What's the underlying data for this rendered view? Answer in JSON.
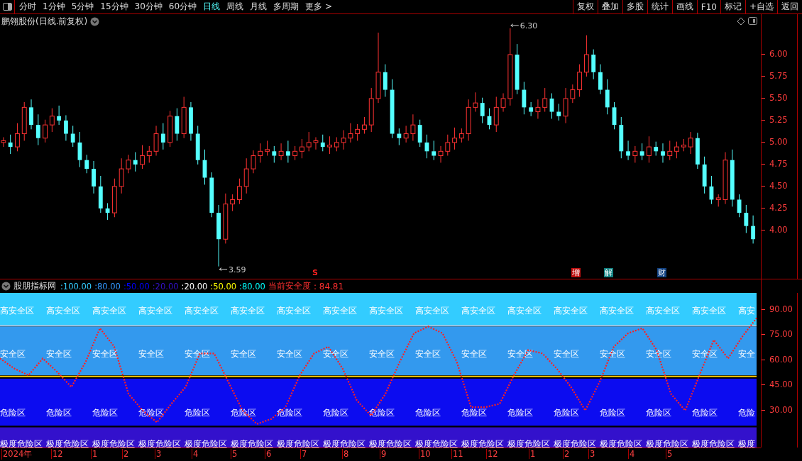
{
  "toolbar": {
    "tabs": [
      {
        "label": "分时",
        "selected": false
      },
      {
        "label": "1分钟",
        "selected": false
      },
      {
        "label": "5分钟",
        "selected": false
      },
      {
        "label": "15分钟",
        "selected": false
      },
      {
        "label": "30分钟",
        "selected": false
      },
      {
        "label": "60分钟",
        "selected": false
      },
      {
        "label": "日线",
        "selected": true
      },
      {
        "label": "周线",
        "selected": false
      },
      {
        "label": "月线",
        "selected": false
      },
      {
        "label": "多周期",
        "selected": false
      },
      {
        "label": "更多 >",
        "selected": false
      }
    ],
    "buttons": [
      "复权",
      "叠加",
      "多股",
      "统计",
      "画线",
      "F10",
      "标记",
      "+自选",
      "返回"
    ]
  },
  "price_panel": {
    "title": "鹏翎股份(日线.前复权)",
    "chart_data": {
      "type": "candlestick",
      "ylim": [
        3.45,
        6.46
      ],
      "yticks": [
        {
          "value": 4,
          "label": "4.00"
        },
        {
          "value": 4.25,
          "label": "4.25"
        },
        {
          "value": 4.5,
          "label": "4.50"
        },
        {
          "value": 4.75,
          "label": "4.75"
        },
        {
          "value": 5,
          "label": "5.00"
        },
        {
          "value": 5.25,
          "label": "5.25"
        },
        {
          "value": 5.5,
          "label": "5.50"
        },
        {
          "value": 5.75,
          "label": "5.75"
        },
        {
          "value": 6,
          "label": "6.00"
        }
      ],
      "ohlc": [
        [
          5.0,
          5.06,
          4.95,
          5.02
        ],
        [
          5.0,
          5.09,
          4.87,
          4.95
        ],
        [
          4.95,
          5.22,
          4.9,
          5.1
        ],
        [
          5.1,
          5.46,
          5.02,
          5.4
        ],
        [
          5.4,
          5.49,
          5.15,
          5.2
        ],
        [
          5.2,
          5.32,
          4.97,
          5.05
        ],
        [
          5.05,
          5.26,
          5.0,
          5.2
        ],
        [
          5.2,
          5.39,
          5.12,
          5.3
        ],
        [
          5.3,
          5.42,
          5.2,
          5.25
        ],
        [
          5.25,
          5.31,
          5.02,
          5.1
        ],
        [
          5.1,
          5.19,
          4.95,
          5.0
        ],
        [
          5.0,
          5.12,
          4.72,
          4.8
        ],
        [
          4.8,
          4.86,
          4.65,
          4.7
        ],
        [
          4.7,
          4.79,
          4.42,
          4.5
        ],
        [
          4.5,
          4.62,
          4.2,
          4.25
        ],
        [
          4.25,
          4.31,
          4.12,
          4.2
        ],
        [
          4.2,
          4.59,
          4.15,
          4.5
        ],
        [
          4.5,
          4.82,
          4.42,
          4.7
        ],
        [
          4.7,
          4.86,
          4.65,
          4.8
        ],
        [
          4.8,
          4.89,
          4.67,
          4.75
        ],
        [
          4.75,
          4.97,
          4.7,
          4.85
        ],
        [
          4.85,
          4.96,
          4.77,
          4.9
        ],
        [
          4.9,
          5.19,
          4.85,
          5.1
        ],
        [
          5.1,
          5.22,
          4.92,
          5.0
        ],
        [
          5.0,
          5.36,
          4.95,
          5.3
        ],
        [
          5.3,
          5.39,
          5.02,
          5.1
        ],
        [
          5.1,
          5.52,
          5.05,
          5.4
        ],
        [
          5.4,
          5.46,
          5.02,
          5.1
        ],
        [
          5.1,
          5.19,
          4.75,
          4.8
        ],
        [
          4.8,
          4.92,
          4.52,
          4.6
        ],
        [
          4.6,
          4.66,
          4.15,
          4.2
        ],
        [
          4.2,
          4.29,
          3.59,
          3.9
        ],
        [
          3.9,
          4.42,
          3.85,
          4.3
        ],
        [
          4.3,
          4.41,
          4.22,
          4.35
        ],
        [
          4.35,
          4.59,
          4.3,
          4.5
        ],
        [
          4.5,
          4.82,
          4.42,
          4.7
        ],
        [
          4.7,
          4.91,
          4.65,
          4.85
        ],
        [
          4.85,
          4.99,
          4.77,
          4.9
        ],
        [
          4.9,
          5.02,
          4.85,
          4.92
        ],
        [
          4.9,
          4.96,
          4.77,
          4.85
        ],
        [
          4.85,
          4.99,
          4.8,
          4.9
        ],
        [
          4.9,
          5.02,
          4.77,
          4.85
        ],
        [
          4.85,
          4.96,
          4.8,
          4.9
        ],
        [
          4.9,
          5.04,
          4.82,
          4.95
        ],
        [
          4.95,
          5.12,
          4.9,
          5.0
        ],
        [
          5.0,
          5.06,
          4.92,
          5.02
        ],
        [
          5.0,
          5.09,
          4.9,
          4.95
        ],
        [
          4.95,
          5.07,
          4.87,
          4.97
        ],
        [
          4.95,
          5.06,
          4.9,
          5.0
        ],
        [
          5.0,
          5.14,
          4.92,
          5.05
        ],
        [
          5.05,
          5.22,
          5.0,
          5.1
        ],
        [
          5.1,
          5.21,
          5.02,
          5.15
        ],
        [
          5.15,
          5.29,
          5.1,
          5.2
        ],
        [
          5.2,
          5.62,
          5.12,
          5.5
        ],
        [
          5.5,
          6.25,
          5.45,
          5.8
        ],
        [
          5.8,
          5.89,
          5.52,
          5.6
        ],
        [
          5.6,
          5.72,
          5.05,
          5.1
        ],
        [
          5.1,
          5.16,
          4.97,
          5.05
        ],
        [
          5.05,
          5.19,
          5.0,
          5.1
        ],
        [
          5.1,
          5.32,
          5.02,
          5.2
        ],
        [
          5.2,
          5.26,
          4.95,
          5.0
        ],
        [
          5.0,
          5.09,
          4.82,
          4.9
        ],
        [
          4.9,
          5.02,
          4.8,
          4.85
        ],
        [
          4.85,
          4.96,
          4.77,
          4.9
        ],
        [
          4.9,
          5.09,
          4.85,
          5.0
        ],
        [
          5.0,
          5.17,
          4.92,
          5.05
        ],
        [
          5.05,
          5.16,
          5.0,
          5.1
        ],
        [
          5.1,
          5.49,
          5.02,
          5.4
        ],
        [
          5.4,
          5.57,
          5.35,
          5.45
        ],
        [
          5.45,
          5.51,
          5.22,
          5.3
        ],
        [
          5.3,
          5.39,
          5.15,
          5.2
        ],
        [
          5.2,
          5.52,
          5.12,
          5.4
        ],
        [
          5.4,
          5.56,
          5.35,
          5.5
        ],
        [
          5.5,
          6.3,
          5.42,
          6.0
        ],
        [
          6.0,
          6.12,
          5.55,
          5.6
        ],
        [
          5.6,
          5.69,
          5.32,
          5.4
        ],
        [
          5.4,
          5.46,
          5.3,
          5.35
        ],
        [
          5.35,
          5.49,
          5.27,
          5.4
        ],
        [
          5.4,
          5.62,
          5.35,
          5.5
        ],
        [
          5.5,
          5.56,
          5.27,
          5.35
        ],
        [
          5.35,
          5.44,
          5.25,
          5.3
        ],
        [
          5.3,
          5.62,
          5.22,
          5.5
        ],
        [
          5.5,
          5.66,
          5.45,
          5.6
        ],
        [
          5.6,
          5.89,
          5.52,
          5.8
        ],
        [
          5.8,
          6.22,
          5.75,
          6.0
        ],
        [
          6.0,
          6.06,
          5.72,
          5.8
        ],
        [
          5.8,
          5.89,
          5.55,
          5.6
        ],
        [
          5.6,
          5.72,
          5.32,
          5.4
        ],
        [
          5.4,
          5.46,
          5.15,
          5.2
        ],
        [
          5.2,
          5.29,
          4.82,
          4.9
        ],
        [
          4.9,
          5.02,
          4.8,
          4.85
        ],
        [
          4.85,
          4.96,
          4.77,
          4.9
        ],
        [
          4.9,
          4.99,
          4.8,
          4.85
        ],
        [
          4.85,
          5.07,
          4.77,
          4.95
        ],
        [
          4.95,
          5.01,
          4.85,
          4.9
        ],
        [
          4.9,
          4.99,
          4.77,
          4.85
        ],
        [
          4.85,
          5.02,
          4.8,
          4.9
        ],
        [
          4.9,
          5.01,
          4.82,
          4.95
        ],
        [
          4.95,
          5.04,
          4.9,
          4.97
        ],
        [
          4.95,
          5.12,
          4.87,
          5.05
        ],
        [
          5.05,
          5.11,
          4.7,
          4.75
        ],
        [
          4.75,
          4.84,
          4.42,
          4.5
        ],
        [
          4.5,
          4.62,
          4.3,
          4.35
        ],
        [
          4.35,
          4.41,
          4.27,
          4.37
        ],
        [
          4.35,
          4.89,
          4.3,
          4.8
        ],
        [
          4.8,
          4.92,
          4.27,
          4.35
        ],
        [
          4.35,
          4.41,
          4.15,
          4.2
        ],
        [
          4.2,
          4.29,
          3.97,
          4.05
        ],
        [
          4.05,
          4.17,
          3.85,
          3.9
        ]
      ],
      "annotations": [
        {
          "text": "6.30"
        },
        {
          "text": "3.59"
        }
      ]
    },
    "markers": [
      {
        "kind": "plain",
        "text": "S",
        "color": "#ff2020"
      },
      {
        "kind": "box",
        "text": "增",
        "color": "#c01010"
      },
      {
        "kind": "box",
        "text": "解",
        "color": "#108080"
      },
      {
        "kind": "box",
        "text": "财",
        "color": "#104080"
      }
    ]
  },
  "indicator_panel": {
    "name": "股朋指标网",
    "legend": [
      {
        "text": ":100.00",
        "color": "#33ccff"
      },
      {
        "text": ":80.00",
        "color": "#3399ff"
      },
      {
        "text": ":50.00",
        "color": "#0000ff"
      },
      {
        "text": ":20.00",
        "color": "#3311cc"
      },
      {
        "text": ":20.00",
        "color": "#ffffff"
      },
      {
        "text": ":50.00",
        "color": "#ffff00"
      },
      {
        "text": ":80.00",
        "color": "#00ffff"
      }
    ],
    "current_label": "当前安全度",
    "current_value": ": 84.81",
    "zones": [
      {
        "labels": [
          "高安全区",
          "高安全区",
          "高安全区",
          "高安全区",
          "高安全区",
          "高安全区",
          "高安全区",
          "高安全区",
          "高安全区",
          "高安全区",
          "高安全区",
          "高安全区",
          "高安全区",
          "高安全区",
          "高安全区",
          "高安全区",
          "高安"
        ]
      },
      {
        "labels": [
          "安全区",
          "安全区",
          "安全区",
          "安全区",
          "安全区",
          "安全区",
          "安全区",
          "安全区",
          "安全区",
          "安全区",
          "安全区",
          "安全区",
          "安全区",
          "安全区",
          "安全区",
          "安全区",
          "安全"
        ]
      },
      {
        "labels": [
          "危险区",
          "危险区",
          "危险区",
          "危险区",
          "危险区",
          "危险区",
          "危险区",
          "危险区",
          "危险区",
          "危险区",
          "危险区",
          "危险区",
          "危险区",
          "危险区",
          "危险区",
          "危险区",
          "危险"
        ]
      },
      {
        "labels": [
          "极度危险区",
          "极度危险区",
          "极度危险区",
          "极度危险区",
          "极度危险区",
          "极度危险区",
          "极度危险区",
          "极度危险区",
          "极度危险区",
          "极度危险区",
          "极度危险区",
          "极度危险区",
          "极度危险区",
          "极度危险区",
          "极度危险区",
          "极度危险区",
          "极度"
        ]
      }
    ],
    "chart_data": {
      "type": "line",
      "line_style": "dashed",
      "ylim": [
        8,
        100
      ],
      "yticks": [
        {
          "value": 30,
          "label": "30.00"
        },
        {
          "value": 45,
          "label": "45.00"
        },
        {
          "value": 60,
          "label": "60.00"
        },
        {
          "value": 75,
          "label": "75.00"
        },
        {
          "value": 90,
          "label": "90.00"
        }
      ],
      "categories": [
        null,
        null,
        null,
        null,
        null,
        null,
        null,
        null,
        null,
        null,
        null,
        null,
        null,
        null,
        null,
        null,
        null,
        null,
        null,
        null,
        null,
        null,
        null,
        null,
        null,
        null,
        null,
        null,
        null,
        null,
        null,
        null,
        null,
        null,
        null,
        null,
        null,
        null,
        null,
        null,
        null,
        null,
        null,
        null,
        null,
        null,
        null,
        null,
        null,
        null,
        null,
        null,
        null,
        null
      ],
      "series": [
        {
          "color": "#ff2020",
          "values": [
            61,
            55,
            51,
            61,
            53,
            44,
            59,
            79,
            68,
            40,
            30,
            23,
            34,
            44,
            64,
            64,
            47,
            30,
            22,
            25,
            32,
            51,
            64,
            68,
            55,
            36,
            27,
            40,
            59,
            76,
            80,
            76,
            59,
            32,
            32,
            34,
            51,
            66,
            64,
            55,
            44,
            30,
            47,
            68,
            76,
            79,
            66,
            40,
            30,
            51,
            72,
            61,
            74,
            85
          ]
        }
      ]
    }
  },
  "date_axis": [
    "2024年",
    "12",
    "1",
    "2",
    "3",
    "4",
    "5",
    "6",
    "7",
    "8",
    "9",
    "10",
    "11",
    "12",
    "1",
    "2",
    "3",
    "4",
    "5"
  ]
}
